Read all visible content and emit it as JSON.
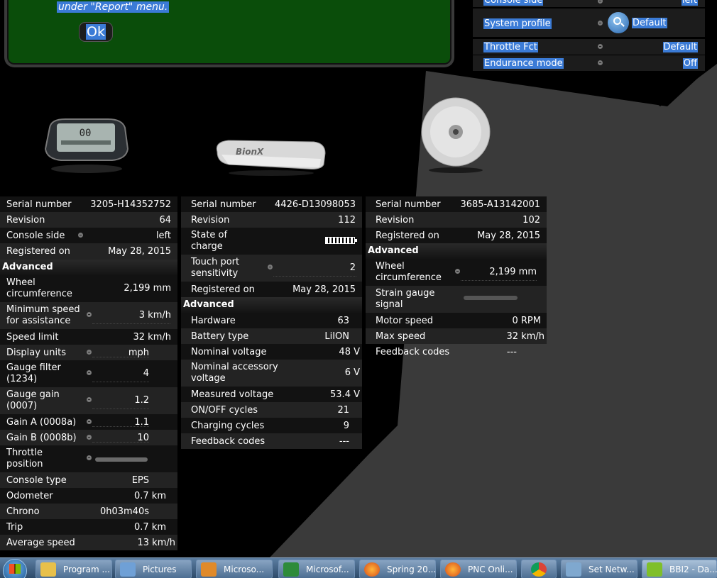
{
  "top_panel": {
    "highlighted_text": "under \"Report\" menu.",
    "ok_label": "Ok"
  },
  "top_settings": {
    "partial_row": {
      "label": "Console side",
      "value": "left"
    },
    "system_profile": {
      "label": "System profile",
      "value": "Default"
    },
    "throttle_fct": {
      "label": "Throttle Fct",
      "value": "Default"
    },
    "endurance_mode": {
      "label": "Endurance mode",
      "value": "Off"
    }
  },
  "console": {
    "rows": [
      {
        "label": "Serial number",
        "value": "3205-H14352752"
      },
      {
        "label": "Revision",
        "value": "64"
      },
      {
        "label": "Console side",
        "value": "left"
      },
      {
        "label": "Registered on",
        "value": "May 28, 2015"
      }
    ],
    "advanced_title": "Advanced",
    "advanced": [
      {
        "label": "Wheel\ncircumference",
        "value": "2,199  mm"
      },
      {
        "label": "Minimum speed\nfor assistance",
        "value": "3  km/h"
      },
      {
        "label": "Speed limit",
        "value": "32  km/h"
      },
      {
        "label": "Display units",
        "value": "mph"
      },
      {
        "label": "Gauge filter\n(1234)",
        "value": "4"
      },
      {
        "label": "Gauge gain\n(0007)",
        "value": "1.2"
      },
      {
        "label": "Gain A (0008a)",
        "value": "1.1"
      },
      {
        "label": "Gain B (0008b)",
        "value": "10"
      },
      {
        "label": "Throttle\nposition",
        "value": ""
      },
      {
        "label": "Console type",
        "value": "EPS"
      },
      {
        "label": "Odometer",
        "value": "0.7  km"
      },
      {
        "label": "Chrono",
        "value": "0h03m40s"
      },
      {
        "label": "Trip",
        "value": "0.7  km"
      },
      {
        "label": "Average speed",
        "value": "13  km/h"
      }
    ]
  },
  "battery": {
    "rows": [
      {
        "label": "Serial number",
        "value": "4426-D13098053"
      },
      {
        "label": "Revision",
        "value": "112"
      },
      {
        "label": "State of\ncharge",
        "value": ""
      },
      {
        "label": "Touch port\nsensitivity",
        "value": "2"
      },
      {
        "label": "Registered on",
        "value": "May 28, 2015"
      }
    ],
    "advanced_title": "Advanced",
    "advanced": [
      {
        "label": "Hardware",
        "value": "63"
      },
      {
        "label": "Battery type",
        "value": "LiION"
      },
      {
        "label": "Nominal voltage",
        "value": "48  V"
      },
      {
        "label": "Nominal accessory\nvoltage",
        "value": "6  V"
      },
      {
        "label": "Measured voltage",
        "value": "53.4  V"
      },
      {
        "label": "ON/OFF cycles",
        "value": "21"
      },
      {
        "label": "Charging cycles",
        "value": "9"
      },
      {
        "label": "Feedback codes",
        "value": "---"
      }
    ]
  },
  "motor": {
    "rows": [
      {
        "label": "Serial number",
        "value": "3685-A13142001"
      },
      {
        "label": "Revision",
        "value": "102"
      },
      {
        "label": "Registered on",
        "value": "May 28, 2015"
      }
    ],
    "advanced_title": "Advanced",
    "advanced": [
      {
        "label": "Wheel\ncircumference",
        "value": "2,199  mm"
      },
      {
        "label": "Strain gauge\nsignal",
        "value": ""
      },
      {
        "label": "Motor speed",
        "value": "0  RPM"
      },
      {
        "label": "Max speed",
        "value": "32  km/h"
      },
      {
        "label": "Feedback codes",
        "value": "---"
      }
    ]
  },
  "taskbar": {
    "items": [
      {
        "label": "Program ..."
      },
      {
        "label": "Pictures"
      },
      {
        "label": "Microso..."
      },
      {
        "label": "Microsof..."
      },
      {
        "label": "Spring 20..."
      },
      {
        "label": "PNC Onli..."
      },
      {
        "label": ""
      },
      {
        "label": "Set Netw..."
      },
      {
        "label": "BBI2 - Da..."
      }
    ]
  },
  "colors": {
    "selection": "#3b7bd6",
    "panel_green": "#0a4d0a",
    "row_dark": "#121212",
    "row_alt": "#232323"
  }
}
